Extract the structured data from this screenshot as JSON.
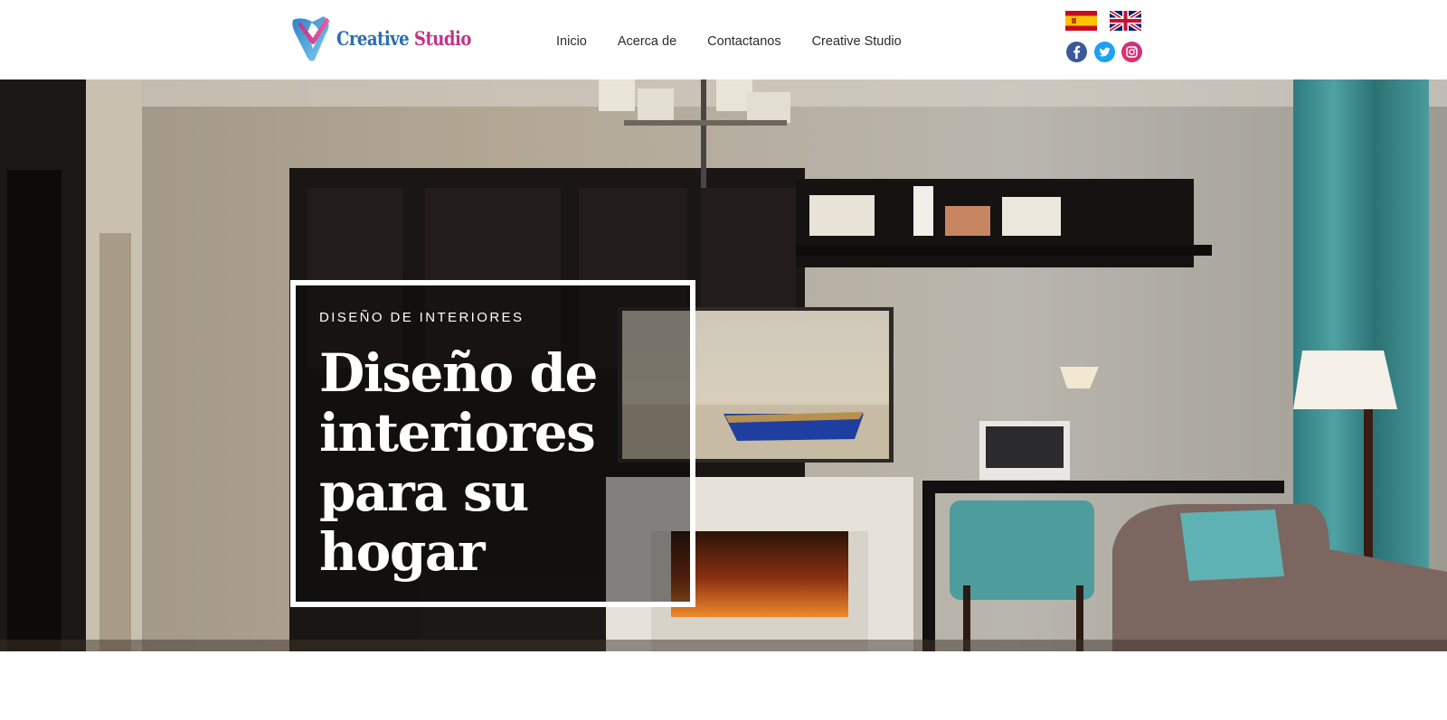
{
  "brand": {
    "name_part1": "Creative",
    "name_part2": "Studio",
    "color_primary": "#2b6db3",
    "color_secondary": "#c2338a"
  },
  "nav": {
    "items": [
      {
        "label": "Inicio"
      },
      {
        "label": "Acerca de"
      },
      {
        "label": "Contactanos"
      },
      {
        "label": "Creative Studio"
      }
    ]
  },
  "languages": [
    {
      "code": "es",
      "icon": "spain-flag-icon"
    },
    {
      "code": "en",
      "icon": "uk-flag-icon"
    }
  ],
  "social": [
    {
      "network": "facebook",
      "icon": "facebook-icon",
      "color": "#3b5998"
    },
    {
      "network": "twitter",
      "icon": "twitter-icon",
      "color": "#1da1f2"
    },
    {
      "network": "instagram",
      "icon": "instagram-icon",
      "color": "#c13584"
    }
  ],
  "hero": {
    "eyebrow": "DISEÑO DE INTERIORES",
    "title_line1": "Diseño de",
    "title_line2": "interiores",
    "title_line3": "para su",
    "title_line4": "hogar"
  }
}
